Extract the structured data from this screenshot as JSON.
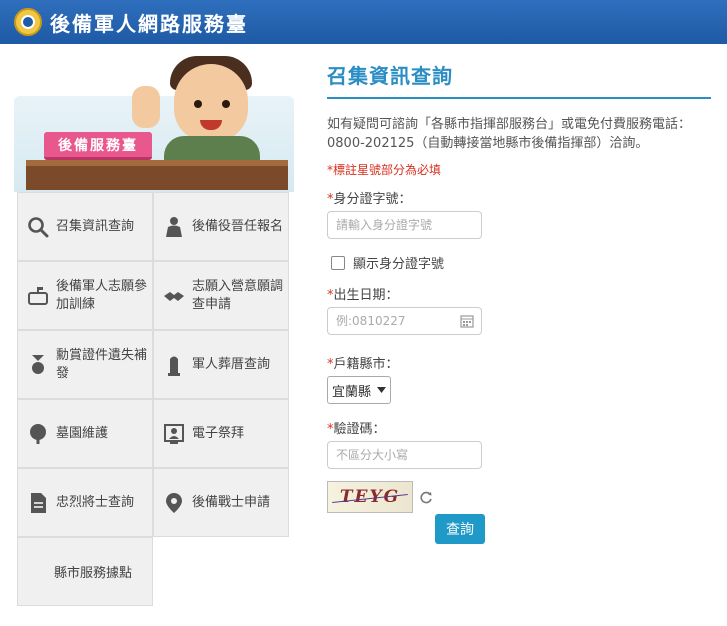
{
  "header": {
    "site_title": "後備軍人網路服務臺",
    "logo_icon": "emblem-icon",
    "background_color": "#1e5aa5"
  },
  "hero": {
    "badge": "後備服務臺"
  },
  "menu": {
    "items": [
      {
        "label": "召集資訊查詢",
        "icon": "search-icon"
      },
      {
        "label": "後備役晉任報名",
        "icon": "person-icon"
      },
      {
        "label": "後備軍人志願參加訓練",
        "icon": "mailbox-icon"
      },
      {
        "label": "志願入營意願調查申請",
        "icon": "handshake-icon"
      },
      {
        "label": "勳賞證件遺失補發",
        "icon": "medal-icon"
      },
      {
        "label": "軍人葬厝查詢",
        "icon": "monument-icon"
      },
      {
        "label": "墓園維護",
        "icon": "tree-icon"
      },
      {
        "label": "電子祭拜",
        "icon": "portrait-icon"
      },
      {
        "label": "忠烈將士查詢",
        "icon": "document-icon"
      },
      {
        "label": "後備戰士申請",
        "icon": "location-pin-icon"
      }
    ],
    "last_item": "縣市服務據點"
  },
  "form": {
    "title": "召集資訊查詢",
    "intro": "如有疑問可諮詢「各縣市指揮部服務台」或電免付費服務電話：0800-202125（自動轉接當地縣市後備指揮部）洽詢。",
    "required_note": "*標註星號部分為必填",
    "id_label": "身分證字號：",
    "id_placeholder": "請輸入身分證字號",
    "show_id_label": "顯示身分證字號",
    "birth_label": "出生日期：",
    "birth_placeholder": "例:0810227",
    "county_label": "戶籍縣市：",
    "county_value": "宜蘭縣",
    "captcha_label": "驗證碼：",
    "captcha_placeholder": "不區分大小寫",
    "captcha_text": "TEYG",
    "submit_label": "查詢",
    "accent_color": "#2a8ec4",
    "required_color": "#d9301f"
  }
}
